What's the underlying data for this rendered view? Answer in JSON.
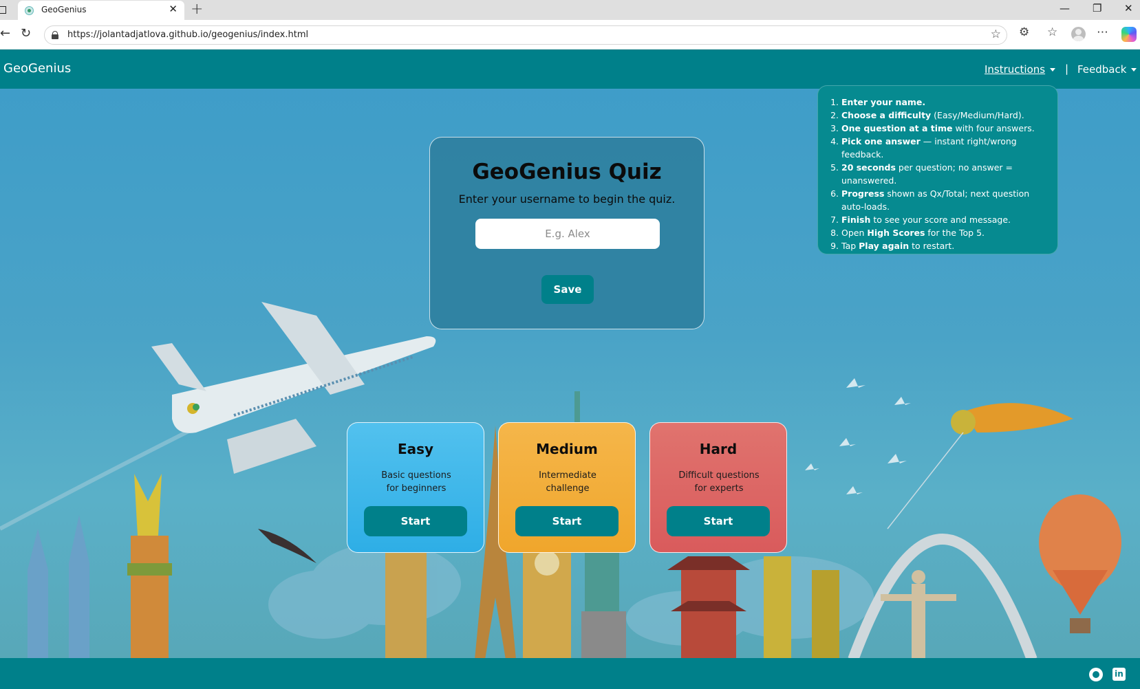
{
  "browser": {
    "tab_title": "GeoGenius",
    "url": "https://jolantadjatlova.github.io/geogenius/index.html",
    "icons": [
      "sidebar-icon",
      "close-icon",
      "new-tab-icon",
      "minimize-icon",
      "restore-icon",
      "back-icon",
      "reload-icon",
      "lock-icon",
      "star-icon",
      "extensions-icon",
      "favorites-icon",
      "profile-icon",
      "more-icon",
      "copilot-icon"
    ]
  },
  "navbar": {
    "brand": "GeoGenius",
    "instructions_label": "Instructions",
    "feedback_label": "Feedback",
    "separator": "|"
  },
  "instructions": [
    {
      "bold": "Enter your name.",
      "rest": ""
    },
    {
      "bold": "Choose a difficulty",
      "rest": " (Easy/Medium/Hard)."
    },
    {
      "bold": "One question at a time",
      "rest": " with four answers."
    },
    {
      "bold": "Pick one answer",
      "rest": " — instant right/wrong feedback."
    },
    {
      "bold": "20 seconds",
      "rest": " per question; no answer = unanswered."
    },
    {
      "bold": "Progress",
      "rest": " shown as Qx/Total; next question auto-loads."
    },
    {
      "pre": "",
      "bold": "Finish",
      "rest": " to see your score and message."
    },
    {
      "pre": "Open ",
      "bold": "High Scores",
      "rest": " for the Top 5."
    },
    {
      "pre": "Tap ",
      "bold": "Play again",
      "rest": " to restart."
    }
  ],
  "card": {
    "title": "GeoGenius Quiz",
    "subtitle": "Enter your username to begin the quiz.",
    "input_placeholder": "E.g. Alex",
    "input_value": "",
    "save_label": "Save"
  },
  "difficulties": [
    {
      "title": "Easy",
      "desc_line1": "Basic questions",
      "desc_line2": "for beginners",
      "button": "Start",
      "color": "#3db6ea"
    },
    {
      "title": "Medium",
      "desc_line1": "Intermediate",
      "desc_line2": "challenge",
      "button": "Start",
      "color": "#f2ad3a"
    },
    {
      "title": "Hard",
      "desc_line1": "Difficult questions",
      "desc_line2": "for experts",
      "button": "Start",
      "color": "#dc6565"
    }
  ],
  "footer": {
    "linkedin_glyph": "in",
    "icons": [
      "github-icon",
      "linkedin-icon"
    ]
  },
  "colors": {
    "teal": "#00808a",
    "sky": "#4aa3c7"
  }
}
